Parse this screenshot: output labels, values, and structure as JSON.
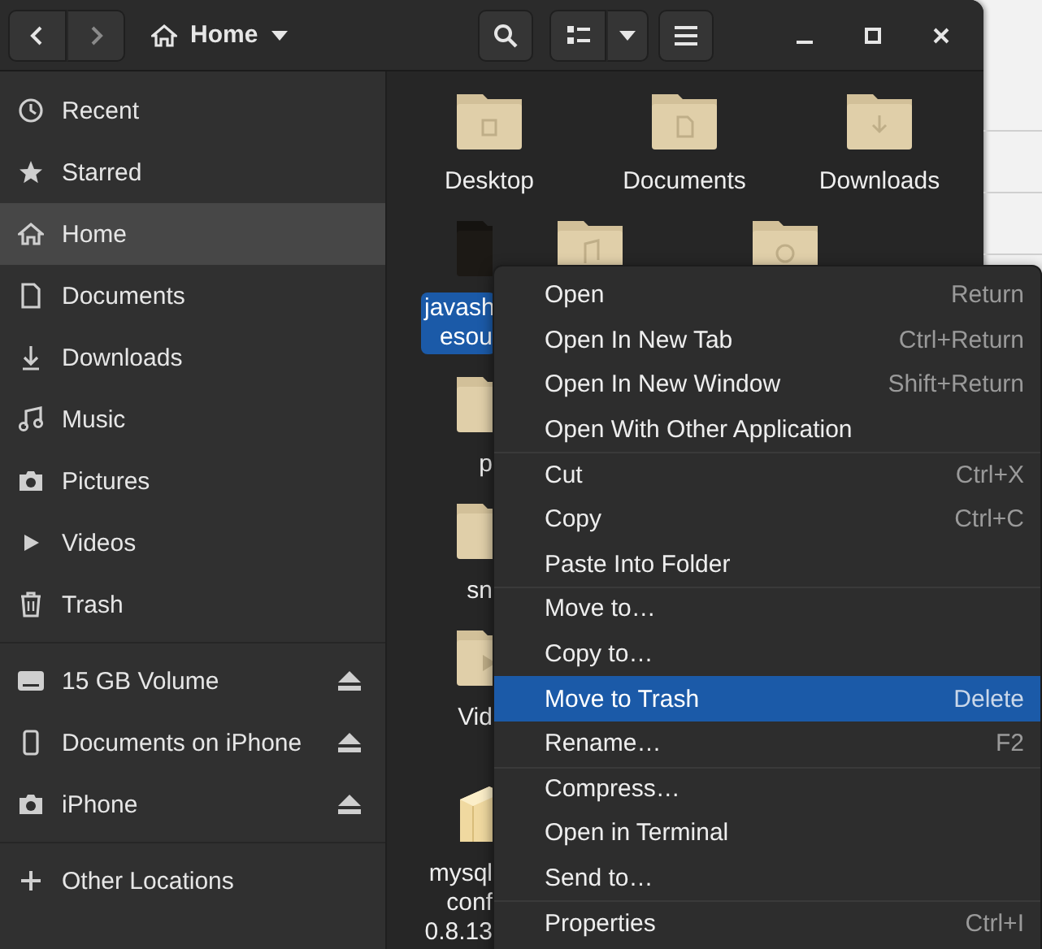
{
  "header": {
    "back_disabled": false,
    "forward_disabled": true,
    "location": "Home"
  },
  "sidebar": {
    "sections": [
      {
        "items": [
          {
            "label": "Recent",
            "selected": false
          },
          {
            "label": "Starred",
            "selected": false
          },
          {
            "label": "Home",
            "selected": true
          },
          {
            "label": "Documents",
            "selected": false
          },
          {
            "label": "Downloads",
            "selected": false
          },
          {
            "label": "Music",
            "selected": false
          },
          {
            "label": "Pictures",
            "selected": false
          },
          {
            "label": "Videos",
            "selected": false
          },
          {
            "label": "Trash",
            "selected": false
          }
        ]
      },
      {
        "items": [
          {
            "label": "15 GB Volume",
            "selected": false
          },
          {
            "label": "Documents on iPhone",
            "selected": false
          },
          {
            "label": "iPhone",
            "selected": false
          }
        ]
      },
      {
        "items": [
          {
            "label": "Other Locations",
            "selected": false
          }
        ]
      }
    ]
  },
  "files": {
    "rows": [
      [
        {
          "kind": "folder",
          "lines": [
            "Desktop"
          ],
          "selected": false
        },
        {
          "kind": "folder",
          "lines": [
            "Documents"
          ],
          "selected": false
        },
        {
          "kind": "folder",
          "lines": [
            "Downloads"
          ],
          "selected": false
        }
      ],
      [
        {
          "kind": "dark-folder",
          "lines": [
            "javash",
            "esou"
          ],
          "selected": true
        },
        {
          "kind": "folder"
        },
        {
          "kind": "folder"
        }
      ],
      [
        {
          "kind": "folder",
          "lines": [
            "p"
          ],
          "selected": false
        }
      ],
      [
        {
          "kind": "folder",
          "lines": [
            "sn"
          ],
          "selected": false
        }
      ],
      [
        {
          "kind": "folder",
          "lines": [
            "Vid"
          ],
          "selected": false
        }
      ],
      [
        {
          "kind": "package",
          "lines": [
            "mysql",
            "conf",
            "0.8.13"
          ],
          "selected": false
        }
      ]
    ]
  },
  "context_menu": {
    "groups": [
      [
        {
          "label": "Open",
          "shortcut": "Return",
          "selected": false
        },
        {
          "label": "Open In New Tab",
          "shortcut": "Ctrl+Return",
          "selected": false
        },
        {
          "label": "Open In New Window",
          "shortcut": "Shift+Return",
          "selected": false
        },
        {
          "label": "Open With Other Application",
          "selected": false
        }
      ],
      [
        {
          "label": "Cut",
          "shortcut": "Ctrl+X",
          "selected": false
        },
        {
          "label": "Copy",
          "shortcut": "Ctrl+C",
          "selected": false
        },
        {
          "label": "Paste Into Folder",
          "selected": false
        }
      ],
      [
        {
          "label": "Move to…",
          "selected": false
        },
        {
          "label": "Copy to…",
          "selected": false
        },
        {
          "label": "Move to Trash",
          "shortcut": "Delete",
          "selected": true
        },
        {
          "label": "Rename…",
          "shortcut": "F2",
          "selected": false
        }
      ],
      [
        {
          "label": "Compress…",
          "selected": false
        },
        {
          "label": "Open in Terminal",
          "selected": false
        },
        {
          "label": "Send to…",
          "selected": false
        }
      ],
      [
        {
          "label": "Properties",
          "shortcut": "Ctrl+I",
          "selected": false
        }
      ]
    ]
  }
}
